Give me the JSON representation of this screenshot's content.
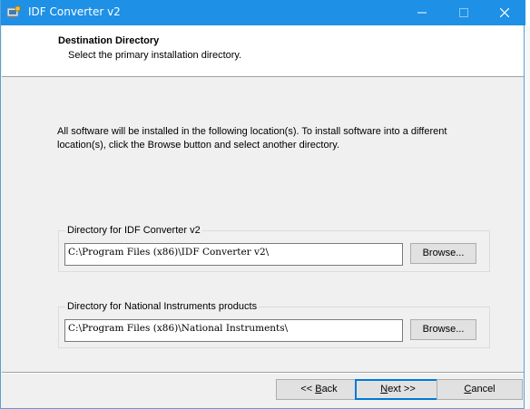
{
  "window": {
    "title": "IDF Converter v2"
  },
  "header": {
    "title": "Destination Directory",
    "subtitle": "Select the primary installation directory."
  },
  "info_text": "All software will be installed in the following location(s). To install software into a different location(s), click the Browse button and select another directory.",
  "directories": [
    {
      "label": "Directory for IDF Converter v2",
      "value": "C:\\Program Files (x86)\\IDF Converter v2\\",
      "browse_label": "Browse..."
    },
    {
      "label": "Directory for National Instruments products",
      "value": "C:\\Program Files (x86)\\National Instruments\\",
      "browse_label": "Browse..."
    }
  ],
  "buttons": {
    "back": {
      "pre": "<< ",
      "hotkey": "B",
      "post": "ack"
    },
    "next": {
      "pre": "",
      "hotkey": "N",
      "post": "ext >>"
    },
    "cancel": {
      "pre": "",
      "hotkey": "C",
      "post": "ancel"
    }
  },
  "colors": {
    "titlebar": "#1e90e6",
    "dialog_bg": "#f0f0f0",
    "default_button_border": "#0078d7"
  }
}
